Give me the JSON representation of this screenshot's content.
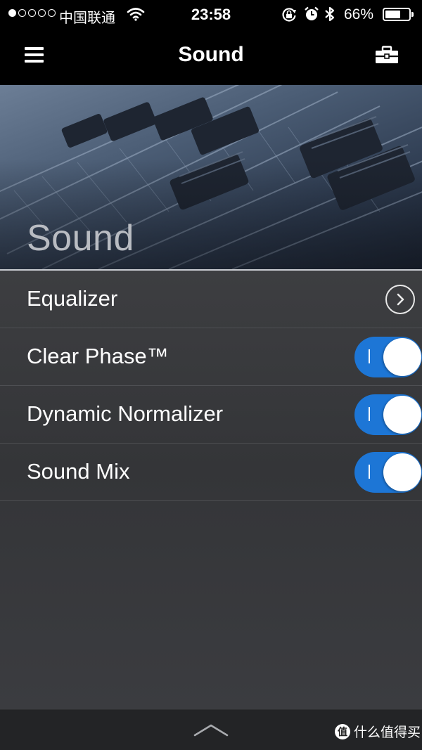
{
  "status_bar": {
    "signal_dots_filled": 1,
    "signal_dots_total": 5,
    "carrier": "中国联通",
    "time": "23:58",
    "battery_percent": "66%",
    "battery_level": 0.66,
    "icons": [
      "wifi-icon",
      "orientation-lock-icon",
      "alarm-icon",
      "bluetooth-icon",
      "battery-icon"
    ]
  },
  "nav": {
    "title": "Sound",
    "left_icon": "hamburger-menu-icon",
    "right_icon": "toolbox-icon"
  },
  "hero": {
    "title": "Sound"
  },
  "settings": [
    {
      "label": "Equalizer",
      "control": "chevron",
      "icon": "chevron-right-icon"
    },
    {
      "label": "Clear Phase™",
      "control": "toggle",
      "on": true
    },
    {
      "label": "Dynamic Normalizer",
      "control": "toggle",
      "on": true
    },
    {
      "label": "Sound Mix",
      "control": "toggle",
      "on": true
    }
  ],
  "bottom_bar": {
    "icon": "chevron-up-icon"
  },
  "watermark": {
    "badge": "值",
    "text": "什么值得买"
  },
  "colors": {
    "toggle_on": "#1d76d6",
    "list_background": "#3a3b3e",
    "nav_background": "#000000"
  }
}
